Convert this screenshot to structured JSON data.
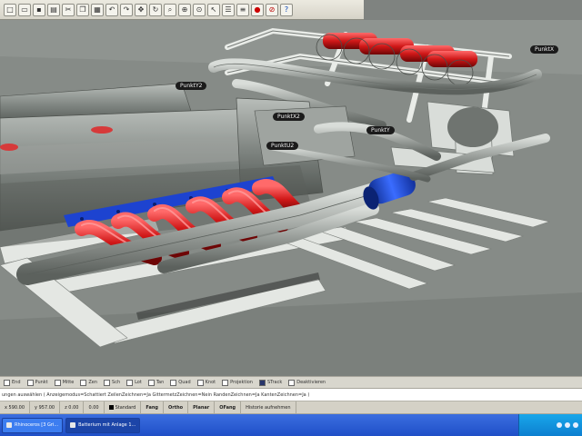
{
  "toolbar": {
    "buttons": [
      "new",
      "open",
      "save",
      "print",
      "cut",
      "copy",
      "paste",
      "undo",
      "redo",
      "pan",
      "rotate",
      "zoom-window",
      "zoom-extents",
      "zoom-selected",
      "select",
      "properties",
      "layers",
      "render",
      "stop",
      "help"
    ]
  },
  "viewport": {
    "labels": {
      "y2": "PunktY2",
      "x2": "PunktX2",
      "u2": "PunktU2",
      "y": "PunktY",
      "x": "PunktX"
    }
  },
  "osnap": {
    "items": [
      {
        "label": "End",
        "checked": false
      },
      {
        "label": "Punkt",
        "checked": false
      },
      {
        "label": "Mitte",
        "checked": false
      },
      {
        "label": "Zen",
        "checked": false
      },
      {
        "label": "Sch",
        "checked": false
      },
      {
        "label": "Lot",
        "checked": false
      },
      {
        "label": "Tan",
        "checked": false
      },
      {
        "label": "Quad",
        "checked": false
      },
      {
        "label": "Knot",
        "checked": false
      },
      {
        "label": "Projektion",
        "checked": false
      },
      {
        "label": "STrack",
        "checked": true
      },
      {
        "label": "Deaktivieren",
        "checked": false
      }
    ]
  },
  "command": {
    "text": "ungen auswählen ( Anzeigemodus=Schattiert ZeilenZeichnen=Ja GittermetzZeichnen=Nein RandenZeichnen=Ja KantenZeichnen=Ja )"
  },
  "status": {
    "x": "x 590.00",
    "y": "y 957.00",
    "z": "z 0.00",
    "extra": "0.00",
    "layer": "Standard",
    "fang": "Fang",
    "ortho": "Ortho",
    "planar": "Planar",
    "ofang": "OFang",
    "history": "Historie aufnehmen"
  },
  "taskbar": {
    "items": [
      {
        "label": "Rhinoceros [3 Gri..."
      },
      {
        "label": "Batterium mit Anlage 1..."
      }
    ]
  }
}
